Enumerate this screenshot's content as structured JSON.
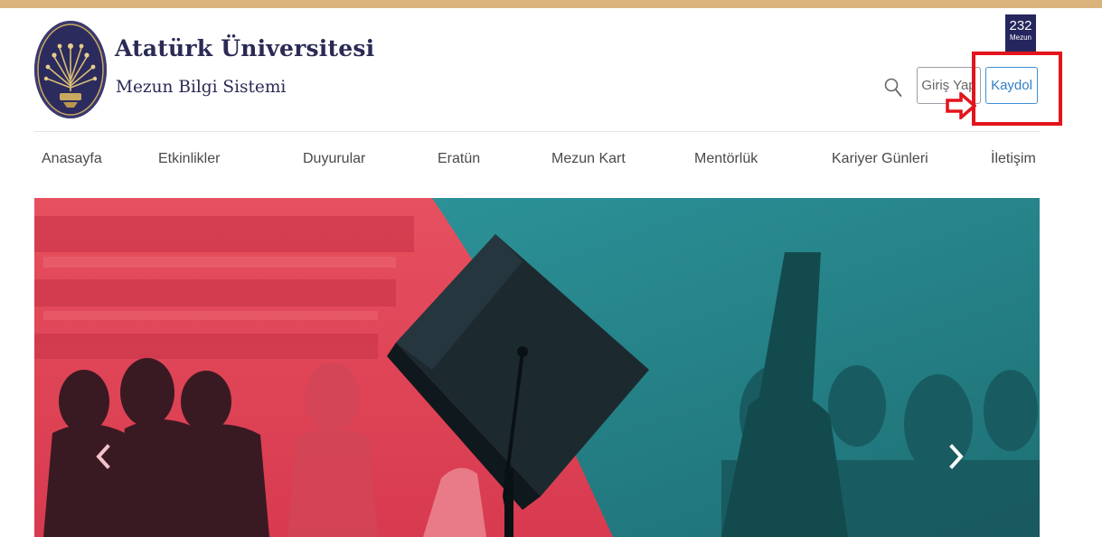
{
  "header": {
    "title": "Atatürk Üniversitesi",
    "subtitle": "Mezun Bilgi Sistemi",
    "counter": {
      "value": "232",
      "label": "Mezun"
    },
    "login_label": "Giriş Yap",
    "register_label": "Kaydol"
  },
  "nav": {
    "items": [
      {
        "label": "Anasayfa"
      },
      {
        "label": "Etkinlikler"
      },
      {
        "label": "Duyurular"
      },
      {
        "label": "Eratün"
      },
      {
        "label": "Mezun Kart"
      },
      {
        "label": "Mentörlük"
      },
      {
        "label": "Kariyer Günleri"
      },
      {
        "label": "İletişim"
      }
    ]
  },
  "hero": {
    "prev_icon": "chevron-left-icon",
    "next_icon": "chevron-right-icon"
  },
  "colors": {
    "top_bar": "#d9b27c",
    "brand": "#2a2a55",
    "counter_bg": "#26265e",
    "register_border": "#3d8fd6",
    "annotation": "#e2141c",
    "hero_red": "#e0475a",
    "hero_teal": "#2d8f95"
  }
}
